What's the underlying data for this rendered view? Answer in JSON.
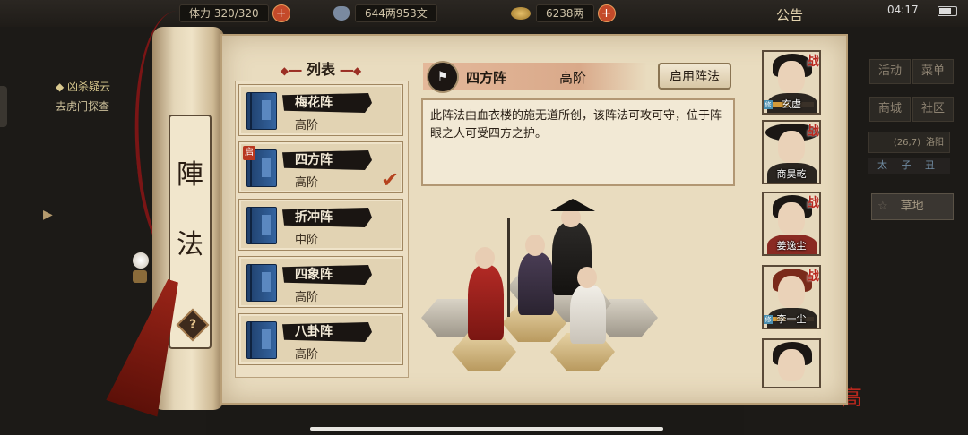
{
  "hud": {
    "stamina": "体力 320/320",
    "silver": "644两953文",
    "gold": "6238两",
    "notice": "公告",
    "time": "04:17"
  },
  "quest": {
    "title": "◆ 凶杀疑云",
    "desc": "去虎门探查"
  },
  "right_menu": [
    "活动",
    "菜单",
    "商城",
    "社区"
  ],
  "city": {
    "name": "洛阳",
    "coords": "(26,7)"
  },
  "timebar": "太 子 丑",
  "terrain": "草地",
  "brand": "高",
  "scroll": {
    "title_1": "陣",
    "title_2": "法",
    "help": "?"
  },
  "list": {
    "title": "列表",
    "items": [
      {
        "name": "梅花阵",
        "grade": "高阶"
      },
      {
        "name": "四方阵",
        "grade": "高阶",
        "badge": "启",
        "selected": true
      },
      {
        "name": "折冲阵",
        "grade": "中阶"
      },
      {
        "name": "四象阵",
        "grade": "高阶"
      },
      {
        "name": "八卦阵",
        "grade": "高阶"
      }
    ]
  },
  "detail": {
    "name": "四方阵",
    "grade": "高阶",
    "enable_label": "启用阵法",
    "description": "此阵法由血衣楼的施无道所创，该阵法可攻可守，位于阵眼之人可受四方之护。"
  },
  "party": [
    {
      "name": "玄虚",
      "battle": "战",
      "exp_badge": "修",
      "exp_progress": 0.4
    },
    {
      "name": "商昊乾",
      "battle": "战"
    },
    {
      "name": "姜逸尘",
      "battle": "战"
    },
    {
      "name": "李一尘",
      "battle": "战",
      "exp_badge": "修",
      "exp_progress": 0.3
    },
    {
      "name": ""
    }
  ]
}
